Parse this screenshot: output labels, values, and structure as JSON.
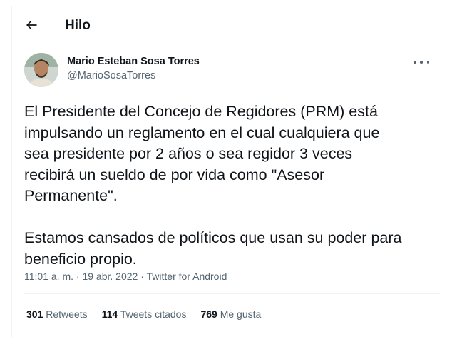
{
  "header": {
    "title": "Hilo",
    "back_icon": "arrow-left-icon"
  },
  "tweet": {
    "author_name": "Mario Esteban Sosa Torres",
    "author_handle": "@MarioSosaTorres",
    "text": "El Presidente del Concejo de Regidores (PRM) está\nimpulsando un reglamento en el cual cualquiera que\nsea presidente por 2 años o sea regidor 3 veces\nrecibirá un sueldo de por vida como \"Asesor\nPermanente\".\n\nEstamos cansados de políticos que usan su poder para\nbeneficio propio.",
    "time": "11:01 a. m.",
    "separator": "·",
    "date": "19 abr. 2022",
    "source": "Twitter for Android"
  },
  "stats": {
    "retweets_count": "301",
    "retweets_label": "Retweets",
    "quotes_count": "114",
    "quotes_label": "Tweets citados",
    "likes_count": "769",
    "likes_label": "Me gusta"
  },
  "colors": {
    "text": "#0f1419",
    "secondary": "#536471",
    "divider": "#eff3f4"
  }
}
